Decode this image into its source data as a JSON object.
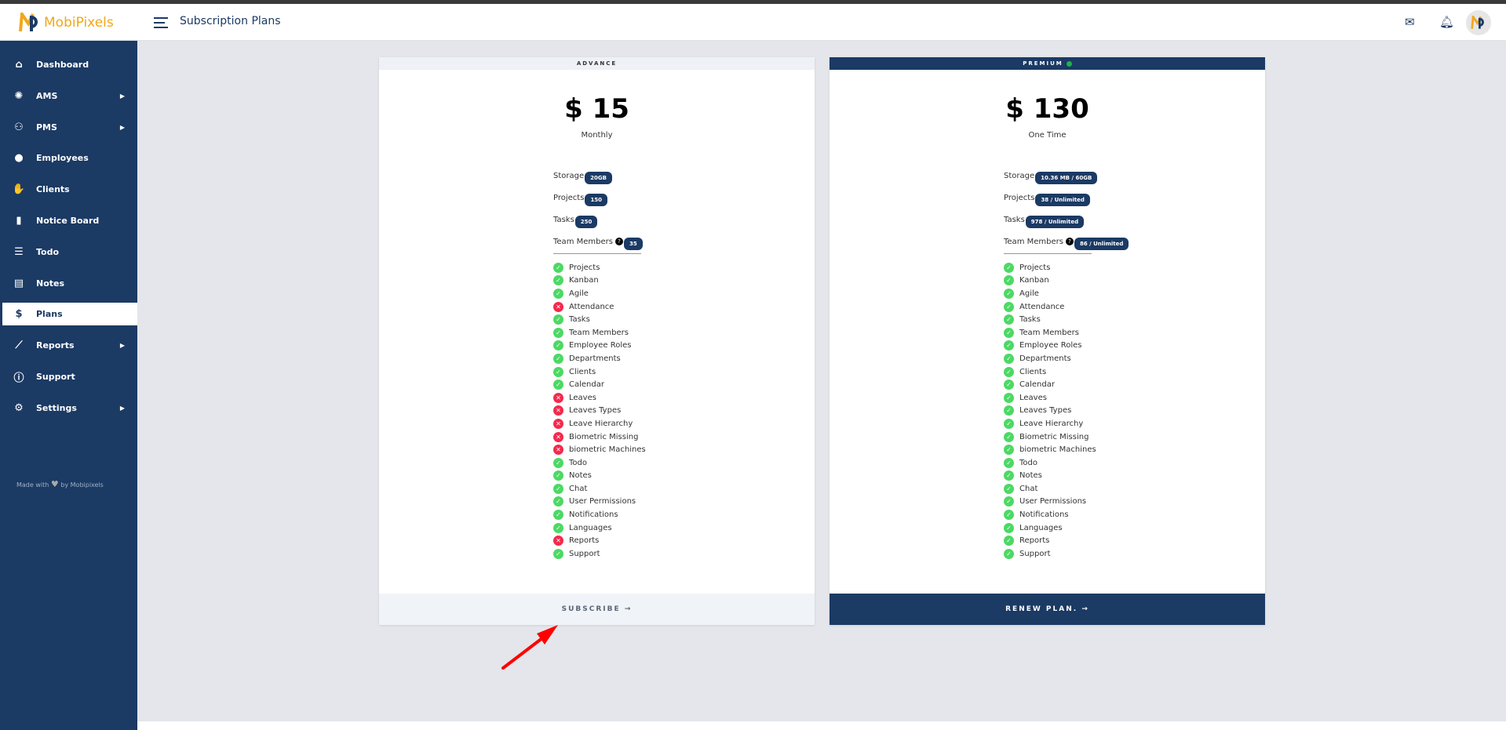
{
  "app": {
    "logo_text": "MobiPixels",
    "page_title": "Subscription Plans",
    "avatar_text": "MobiPixels"
  },
  "header_icons": [
    "mail-icon",
    "bell-icon"
  ],
  "sidebar": {
    "items": [
      {
        "label": "Dashboard",
        "icon": "home-icon",
        "glyph": "⌂",
        "submenu": false
      },
      {
        "label": "AMS",
        "icon": "brain-icon",
        "glyph": "✺",
        "submenu": true
      },
      {
        "label": "PMS",
        "icon": "network-icon",
        "glyph": "⚇",
        "submenu": true
      },
      {
        "label": "Employees",
        "icon": "user-icon",
        "glyph": "●",
        "submenu": false
      },
      {
        "label": "Clients",
        "icon": "handshake-icon",
        "glyph": "✋",
        "submenu": false
      },
      {
        "label": "Notice Board",
        "icon": "clipboard-icon",
        "glyph": "▮",
        "submenu": false
      },
      {
        "label": "Todo",
        "icon": "checklist-icon",
        "glyph": "☰",
        "submenu": false
      },
      {
        "label": "Notes",
        "icon": "file-icon",
        "glyph": "▤",
        "submenu": false
      },
      {
        "label": "Plans",
        "icon": "dollar-icon",
        "glyph": "$",
        "submenu": false,
        "active": true
      },
      {
        "label": "Reports",
        "icon": "chart-icon",
        "glyph": "⟋",
        "submenu": true
      },
      {
        "label": "Support",
        "icon": "info-icon",
        "glyph": "ⓘ",
        "submenu": false
      },
      {
        "label": "Settings",
        "icon": "gear-icon",
        "glyph": "⚙",
        "submenu": true
      }
    ],
    "made_with": "Made with",
    "made_by": "by Mobipixels"
  },
  "plans": [
    {
      "name": "ADVANCE",
      "price": "$ 15",
      "period": "Monthly",
      "button": "SUBSCRIBE",
      "highlight": false,
      "limits": [
        {
          "label": "Storage",
          "value": "20GB"
        },
        {
          "label": "Projects",
          "value": "150"
        },
        {
          "label": "Tasks",
          "value": "250"
        },
        {
          "label": "Team Members",
          "value": "35",
          "help": true
        }
      ],
      "features": [
        [
          "Projects",
          true
        ],
        [
          "Kanban",
          true
        ],
        [
          "Agile",
          true
        ],
        [
          "Attendance",
          false
        ],
        [
          "Tasks",
          true
        ],
        [
          "Team Members",
          true
        ],
        [
          "Employee Roles",
          true
        ],
        [
          "Departments",
          true
        ],
        [
          "Clients",
          true
        ],
        [
          "Calendar",
          true
        ],
        [
          "Leaves",
          false
        ],
        [
          "Leaves Types",
          false
        ],
        [
          "Leave Hierarchy",
          false
        ],
        [
          "Biometric Missing",
          false
        ],
        [
          "biometric Machines",
          false
        ],
        [
          "Todo",
          true
        ],
        [
          "Notes",
          true
        ],
        [
          "Chat",
          true
        ],
        [
          "User Permissions",
          true
        ],
        [
          "Notifications",
          true
        ],
        [
          "Languages",
          true
        ],
        [
          "Reports",
          false
        ],
        [
          "Support",
          true
        ]
      ]
    },
    {
      "name": "PREMIUM",
      "price": "$ 130",
      "period": "One Time",
      "button": "RENEW PLAN.",
      "highlight": true,
      "current": true,
      "limits": [
        {
          "label": "Storage",
          "value": "10.36 MB / 60GB"
        },
        {
          "label": "Projects",
          "value": "38 / Unlimited"
        },
        {
          "label": "Tasks",
          "value": "978 / Unlimited"
        },
        {
          "label": "Team Members",
          "value": "86 / Unlimited",
          "help": true
        }
      ],
      "features": [
        [
          "Projects",
          true
        ],
        [
          "Kanban",
          true
        ],
        [
          "Agile",
          true
        ],
        [
          "Attendance",
          true
        ],
        [
          "Tasks",
          true
        ],
        [
          "Team Members",
          true
        ],
        [
          "Employee Roles",
          true
        ],
        [
          "Departments",
          true
        ],
        [
          "Clients",
          true
        ],
        [
          "Calendar",
          true
        ],
        [
          "Leaves",
          true
        ],
        [
          "Leaves Types",
          true
        ],
        [
          "Leave Hierarchy",
          true
        ],
        [
          "Biometric Missing",
          true
        ],
        [
          "biometric Machines",
          true
        ],
        [
          "Todo",
          true
        ],
        [
          "Notes",
          true
        ],
        [
          "Chat",
          true
        ],
        [
          "User Permissions",
          true
        ],
        [
          "Notifications",
          true
        ],
        [
          "Languages",
          true
        ],
        [
          "Reports",
          true
        ],
        [
          "Support",
          true
        ]
      ]
    }
  ],
  "colors": {
    "brand": "#1b3a64",
    "logo": "#f0a81c",
    "ok": "#4cd964",
    "no": "#f5294d",
    "annotation": "#ff0000"
  }
}
